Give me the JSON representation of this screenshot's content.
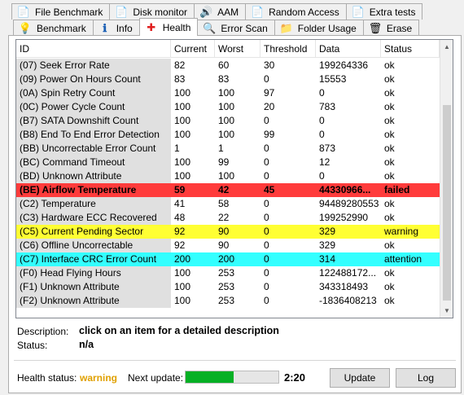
{
  "tabs_top": [
    {
      "label": "File Benchmark",
      "icon": "file-benchmark-icon",
      "glyph": "📄"
    },
    {
      "label": "Disk monitor",
      "icon": "disk-monitor-icon",
      "glyph": "📄"
    },
    {
      "label": "AAM",
      "icon": "speaker-icon",
      "glyph": "🔊"
    },
    {
      "label": "Random Access",
      "icon": "random-access-icon",
      "glyph": "📄"
    },
    {
      "label": "Extra tests",
      "icon": "extra-tests-icon",
      "glyph": "📄"
    }
  ],
  "tabs_bottom": [
    {
      "label": "Benchmark",
      "icon": "lightbulb-icon",
      "glyph": "💡",
      "active": false
    },
    {
      "label": "Info",
      "icon": "info-icon",
      "glyph": "ℹ",
      "active": false
    },
    {
      "label": "Health",
      "icon": "health-cross-icon",
      "glyph": "✚",
      "active": true
    },
    {
      "label": "Error Scan",
      "icon": "magnifier-icon",
      "glyph": "🔍",
      "active": false
    },
    {
      "label": "Folder Usage",
      "icon": "folder-icon",
      "glyph": "📁",
      "active": false
    },
    {
      "label": "Erase",
      "icon": "trash-icon",
      "glyph": "🗑",
      "active": false
    }
  ],
  "columns": [
    "ID",
    "Current",
    "Worst",
    "Threshold",
    "Data",
    "Status"
  ],
  "rows": [
    {
      "id": "(07) Seek Error Rate",
      "current": "82",
      "worst": "60",
      "threshold": "30",
      "data": "199264336",
      "status": "ok",
      "highlight": ""
    },
    {
      "id": "(09) Power On Hours Count",
      "current": "83",
      "worst": "83",
      "threshold": "0",
      "data": "15553",
      "status": "ok",
      "highlight": ""
    },
    {
      "id": "(0A) Spin Retry Count",
      "current": "100",
      "worst": "100",
      "threshold": "97",
      "data": "0",
      "status": "ok",
      "highlight": ""
    },
    {
      "id": "(0C) Power Cycle Count",
      "current": "100",
      "worst": "100",
      "threshold": "20",
      "data": "783",
      "status": "ok",
      "highlight": ""
    },
    {
      "id": "(B7) SATA Downshift Count",
      "current": "100",
      "worst": "100",
      "threshold": "0",
      "data": "0",
      "status": "ok",
      "highlight": ""
    },
    {
      "id": "(B8) End To End Error Detection",
      "current": "100",
      "worst": "100",
      "threshold": "99",
      "data": "0",
      "status": "ok",
      "highlight": ""
    },
    {
      "id": "(BB) Uncorrectable Error Count",
      "current": "1",
      "worst": "1",
      "threshold": "0",
      "data": "873",
      "status": "ok",
      "highlight": ""
    },
    {
      "id": "(BC) Command Timeout",
      "current": "100",
      "worst": "99",
      "threshold": "0",
      "data": "12",
      "status": "ok",
      "highlight": ""
    },
    {
      "id": "(BD) Unknown Attribute",
      "current": "100",
      "worst": "100",
      "threshold": "0",
      "data": "0",
      "status": "ok",
      "highlight": ""
    },
    {
      "id": "(BE) Airflow Temperature",
      "current": "59",
      "worst": "42",
      "threshold": "45",
      "data": "44330966...",
      "status": "failed",
      "highlight": "red"
    },
    {
      "id": "(C2) Temperature",
      "current": "41",
      "worst": "58",
      "threshold": "0",
      "data": "94489280553",
      "status": "ok",
      "highlight": ""
    },
    {
      "id": "(C3) Hardware ECC Recovered",
      "current": "48",
      "worst": "22",
      "threshold": "0",
      "data": "199252990",
      "status": "ok",
      "highlight": ""
    },
    {
      "id": "(C5) Current Pending Sector",
      "current": "92",
      "worst": "90",
      "threshold": "0",
      "data": "329",
      "status": "warning",
      "highlight": "yellow"
    },
    {
      "id": "(C6) Offline Uncorrectable",
      "current": "92",
      "worst": "90",
      "threshold": "0",
      "data": "329",
      "status": "ok",
      "highlight": ""
    },
    {
      "id": "(C7) Interface CRC Error Count",
      "current": "200",
      "worst": "200",
      "threshold": "0",
      "data": "314",
      "status": "attention",
      "highlight": "cyan"
    },
    {
      "id": "(F0) Head Flying Hours",
      "current": "100",
      "worst": "253",
      "threshold": "0",
      "data": "122488172...",
      "status": "ok",
      "highlight": ""
    },
    {
      "id": "(F1) Unknown Attribute",
      "current": "100",
      "worst": "253",
      "threshold": "0",
      "data": "343318493",
      "status": "ok",
      "highlight": ""
    },
    {
      "id": "(F2) Unknown Attribute",
      "current": "100",
      "worst": "253",
      "threshold": "0",
      "data": "-1836408213",
      "status": "ok",
      "highlight": ""
    }
  ],
  "description": {
    "label": "Description:",
    "value": "click on an item for a detailed description",
    "status_label": "Status:",
    "status_value": "n/a"
  },
  "footer": {
    "health_status_label": "Health status:",
    "health_status_value": "warning",
    "health_status_color": "#e0a000",
    "next_update_label": "Next update:",
    "next_update_progress": 0.52,
    "timer": "2:20",
    "update_button": "Update",
    "log_button": "Log"
  }
}
